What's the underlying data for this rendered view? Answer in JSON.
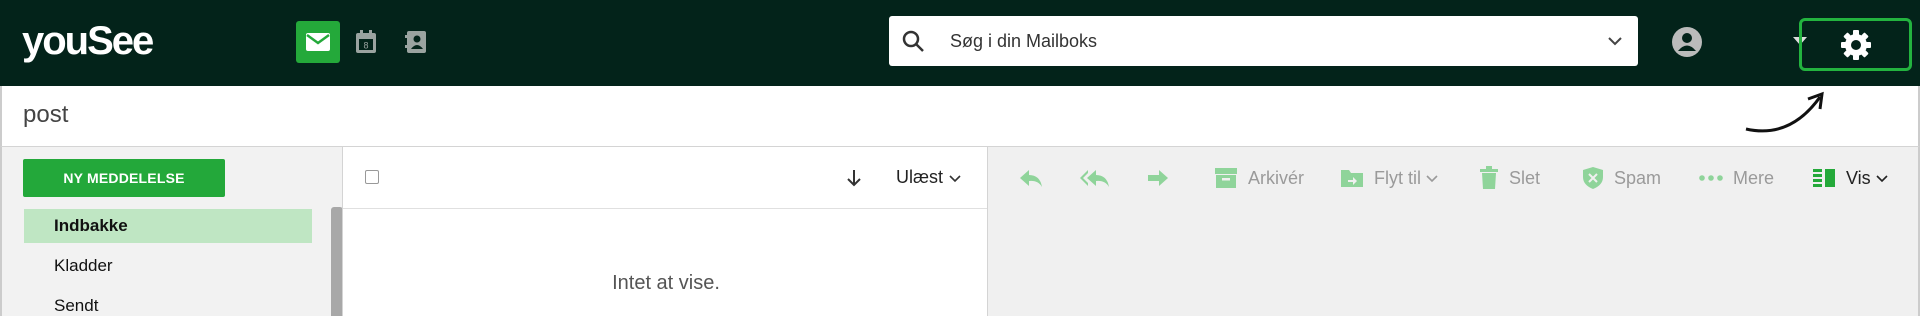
{
  "brand": {
    "logo_text": "youSee"
  },
  "apps": [
    {
      "name": "mail",
      "active": true
    },
    {
      "name": "calendar",
      "active": false,
      "day": "8"
    },
    {
      "name": "contacts",
      "active": false
    }
  ],
  "search": {
    "placeholder": "Søg i din Mailboks"
  },
  "page": {
    "title": "post"
  },
  "sidebar": {
    "compose_label": "NY MEDDELELSE",
    "folders": [
      {
        "label": "Indbakke",
        "selected": true
      },
      {
        "label": "Kladder",
        "selected": false
      },
      {
        "label": "Sendt",
        "selected": false
      }
    ]
  },
  "list": {
    "filter_label": "Ulæst",
    "empty_text": "Intet at vise."
  },
  "toolbar": {
    "archive_label": "Arkivér",
    "move_label": "Flyt til",
    "delete_label": "Slet",
    "spam_label": "Spam",
    "more_label": "Mere",
    "view_label": "Vis"
  },
  "colors": {
    "topbar": "#03231a",
    "accent": "#24a93a",
    "selected_folder": "#bfe6c3",
    "toolbar_icon": "#8fd49a",
    "highlight_box": "#23b33f"
  }
}
